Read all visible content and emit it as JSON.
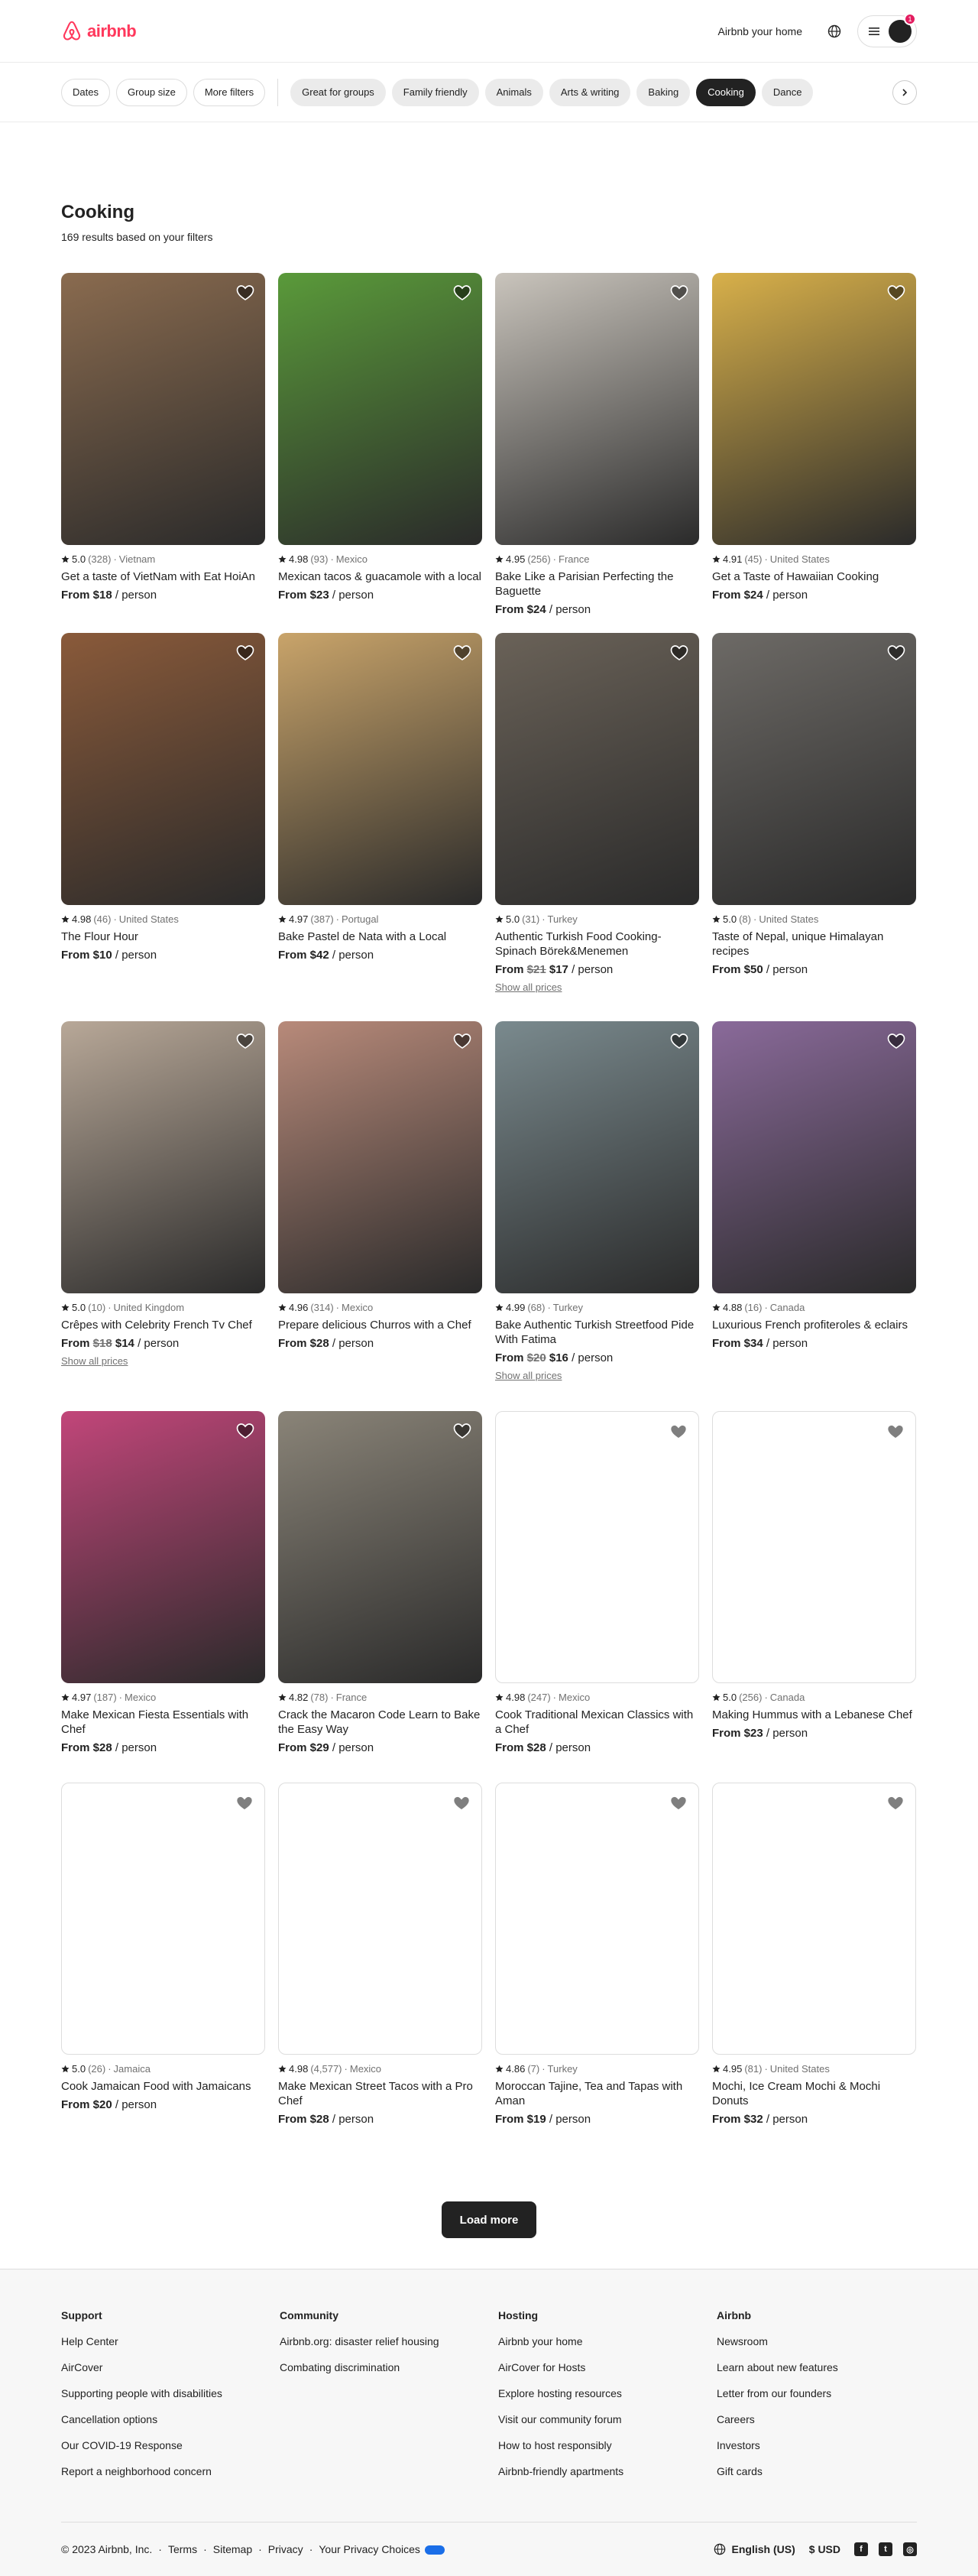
{
  "header": {
    "logo_text": "airbnb",
    "host_link": "Airbnb your home",
    "notifications": "1"
  },
  "filters": {
    "primary": [
      "Dates",
      "Group size",
      "More filters"
    ],
    "categories": [
      {
        "label": "Great for groups",
        "active": false
      },
      {
        "label": "Family friendly",
        "active": false
      },
      {
        "label": "Animals",
        "active": false
      },
      {
        "label": "Arts & writing",
        "active": false
      },
      {
        "label": "Baking",
        "active": false
      },
      {
        "label": "Cooking",
        "active": true
      },
      {
        "label": "Dance",
        "active": false
      }
    ]
  },
  "page": {
    "title": "Cooking",
    "results": "169 results based on your filters"
  },
  "listings": [
    {
      "rating": "5.0",
      "reviews": "(328)",
      "location": "Vietnam",
      "title": "Get a taste of VietNam with Eat HoiAn",
      "price_from": "From $18",
      "old_price": "",
      "per": "/ person",
      "show_all": "",
      "photo": "#8a6b4f"
    },
    {
      "rating": "4.98",
      "reviews": "(93)",
      "location": "Mexico",
      "title": "Mexican tacos & guacamole with a local",
      "price_from": "From $23",
      "old_price": "",
      "per": "/ person",
      "show_all": "",
      "photo": "#5a9a3a"
    },
    {
      "rating": "4.95",
      "reviews": "(256)",
      "location": "France",
      "title": "Bake Like a Parisian Perfecting the Baguette",
      "price_from": "From $24",
      "old_price": "",
      "per": "/ person",
      "show_all": "",
      "photo": "#c9c4bc"
    },
    {
      "rating": "4.91",
      "reviews": "(45)",
      "location": "United States",
      "title": "Get a Taste of Hawaiian Cooking",
      "price_from": "From $24",
      "old_price": "",
      "per": "/ person",
      "show_all": "",
      "photo": "#d8b04a"
    },
    {
      "rating": "4.98",
      "reviews": "(46)",
      "location": "United States",
      "title": "The Flour Hour",
      "price_from": "From $10",
      "old_price": "",
      "per": "/ person",
      "show_all": "",
      "photo": "#8a5a3a"
    },
    {
      "rating": "4.97",
      "reviews": "(387)",
      "location": "Portugal",
      "title": "Bake Pastel de Nata with a Local",
      "price_from": "From $42",
      "old_price": "",
      "per": "/ person",
      "show_all": "",
      "photo": "#c9a46a"
    },
    {
      "rating": "5.0",
      "reviews": "(31)",
      "location": "Turkey",
      "title": "Authentic Turkish Food Cooking-Spinach Börek&Menemen",
      "price_from": "From",
      "old_price": "$21",
      "price_new": "$17",
      "per": "/ person",
      "show_all": "Show all prices",
      "photo": "#6a6258"
    },
    {
      "rating": "5.0",
      "reviews": "(8)",
      "location": "United States",
      "title": "Taste of Nepal, unique Himalayan recipes",
      "price_from": "From $50",
      "old_price": "",
      "per": "/ person",
      "show_all": "",
      "photo": "#6d6a66"
    },
    {
      "rating": "5.0",
      "reviews": "(10)",
      "location": "United Kingdom",
      "title": "Crêpes with Celebrity French Tv Chef",
      "price_from": "From",
      "old_price": "$18",
      "price_new": "$14",
      "per": "/ person",
      "show_all": "Show all prices",
      "photo": "#b8a898"
    },
    {
      "rating": "4.96",
      "reviews": "(314)",
      "location": "Mexico",
      "title": "Prepare delicious Churros with a Chef",
      "price_from": "From $28",
      "old_price": "",
      "per": "/ person",
      "show_all": "",
      "photo": "#b88a7a"
    },
    {
      "rating": "4.99",
      "reviews": "(68)",
      "location": "Turkey",
      "title": "Bake Authentic Turkish Streetfood Pide With Fatima",
      "price_from": "From",
      "old_price": "$20",
      "price_new": "$16",
      "per": "/ person",
      "show_all": "Show all prices",
      "photo": "#7a8a8e"
    },
    {
      "rating": "4.88",
      "reviews": "(16)",
      "location": "Canada",
      "title": "Luxurious French profiteroles & eclairs",
      "price_from": "From $34",
      "old_price": "",
      "per": "/ person",
      "show_all": "",
      "photo": "#8a6a9a"
    },
    {
      "rating": "4.97",
      "reviews": "(187)",
      "location": "Mexico",
      "title": "Make Mexican Fiesta Essentials with Chef",
      "price_from": "From $28",
      "old_price": "",
      "per": "/ person",
      "show_all": "",
      "photo": "#c2467a"
    },
    {
      "rating": "4.82",
      "reviews": "(78)",
      "location": "France",
      "title": "Crack the Macaron Code Learn to Bake the Easy Way",
      "price_from": "From $29",
      "old_price": "",
      "per": "/ person",
      "show_all": "",
      "photo": "#8a8478"
    },
    {
      "rating": "4.98",
      "reviews": "(247)",
      "location": "Mexico",
      "title": "Cook Traditional Mexican Classics with a Chef",
      "price_from": "From $28",
      "old_price": "",
      "per": "/ person",
      "show_all": "",
      "photo": ""
    },
    {
      "rating": "5.0",
      "reviews": "(256)",
      "location": "Canada",
      "title": "Making Hummus with a Lebanese Chef",
      "price_from": "From $23",
      "old_price": "",
      "per": "/ person",
      "show_all": "",
      "photo": ""
    },
    {
      "rating": "5.0",
      "reviews": "(26)",
      "location": "Jamaica",
      "title": "Cook Jamaican Food with Jamaicans",
      "price_from": "From $20",
      "old_price": "",
      "per": "/ person",
      "show_all": "",
      "photo": ""
    },
    {
      "rating": "4.98",
      "reviews": "(4,577)",
      "location": "Mexico",
      "title": "Make Mexican Street Tacos with a Pro Chef",
      "price_from": "From $28",
      "old_price": "",
      "per": "/ person",
      "show_all": "",
      "photo": ""
    },
    {
      "rating": "4.86",
      "reviews": "(7)",
      "location": "Turkey",
      "title": "Moroccan Tajine, Tea and Tapas with Aman",
      "price_from": "From $19",
      "old_price": "",
      "per": "/ person",
      "show_all": "",
      "photo": ""
    },
    {
      "rating": "4.95",
      "reviews": "(81)",
      "location": "United States",
      "title": "Mochi, Ice Cream Mochi & Mochi Donuts",
      "price_from": "From $32",
      "old_price": "",
      "per": "/ person",
      "show_all": "",
      "photo": ""
    }
  ],
  "load_more": "Load more",
  "footer": {
    "columns": [
      {
        "title": "Support",
        "links": [
          "Help Center",
          "AirCover",
          "Supporting people with disabilities",
          "Cancellation options",
          "Our COVID-19 Response",
          "Report a neighborhood concern"
        ]
      },
      {
        "title": "Community",
        "links": [
          "Airbnb.org: disaster relief housing",
          "Combating discrimination"
        ]
      },
      {
        "title": "Hosting",
        "links": [
          "Airbnb your home",
          "AirCover for Hosts",
          "Explore hosting resources",
          "Visit our community forum",
          "How to host responsibly",
          "Airbnb-friendly apartments"
        ]
      },
      {
        "title": "Airbnb",
        "links": [
          "Newsroom",
          "Learn about new features",
          "Letter from our founders",
          "Careers",
          "Investors",
          "Gift cards"
        ]
      }
    ],
    "copyright": "© 2023 Airbnb, Inc.",
    "legal": [
      "Terms",
      "Sitemap",
      "Privacy",
      "Your Privacy Choices"
    ],
    "language": "English (US)",
    "currency": "$ USD"
  }
}
